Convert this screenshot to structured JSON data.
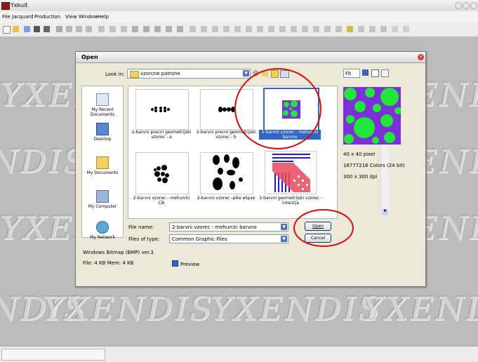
{
  "app": {
    "title": "Yxkuit"
  },
  "menu": [
    "File",
    "Jacquard",
    "Production",
    "View",
    "Window",
    "Help"
  ],
  "watermark": "YXENDIS",
  "dialog": {
    "title": "Open",
    "lookin_label": "Look in:",
    "lookin_value": "vzorcne patrone",
    "places": [
      "My Recent Documents",
      "Desktop",
      "My Documents",
      "My Computer",
      "My Network"
    ],
    "files": [
      {
        "caption": "2-barvni precni geometrijski vzorec - a",
        "selected": false
      },
      {
        "caption": "2-barvni precni geometrijski vzorec - b",
        "selected": false
      },
      {
        "caption": "2-barvni vzorec - mehurcki barvno",
        "selected": true
      },
      {
        "caption": "2-barvni vzorec - mehurcki CB",
        "selected": false
      },
      {
        "caption": "2-barvni vzorec -pike elipse",
        "selected": false
      },
      {
        "caption": "3-barvni geometrijski vzorec - intarzija",
        "selected": false
      }
    ],
    "filename_label": "File name:",
    "filename_value": "2-barvni vzorec - mehurcki barvno",
    "filetype_label": "Files of type:",
    "filetype_value": "Common Graphic Files",
    "open_button": "Open",
    "cancel_button": "Cancel",
    "format_info": "Windows Bitmap (BMP) ver.3",
    "size_info": "File: 4 KB   Mem: 4 KB",
    "preview_checkbox": "Preview",
    "preview_checked": true,
    "preview_mode": "Fit",
    "preview_info": [
      "40 x 40 pixel",
      "16777216 Colors (24 bit)",
      "300 x 300 dpi"
    ]
  },
  "colors": {
    "preview_bg": "#7b2fd6",
    "preview_dot": "#22e63a",
    "highlight": "#e00a0a",
    "selection": "#3166c6"
  }
}
